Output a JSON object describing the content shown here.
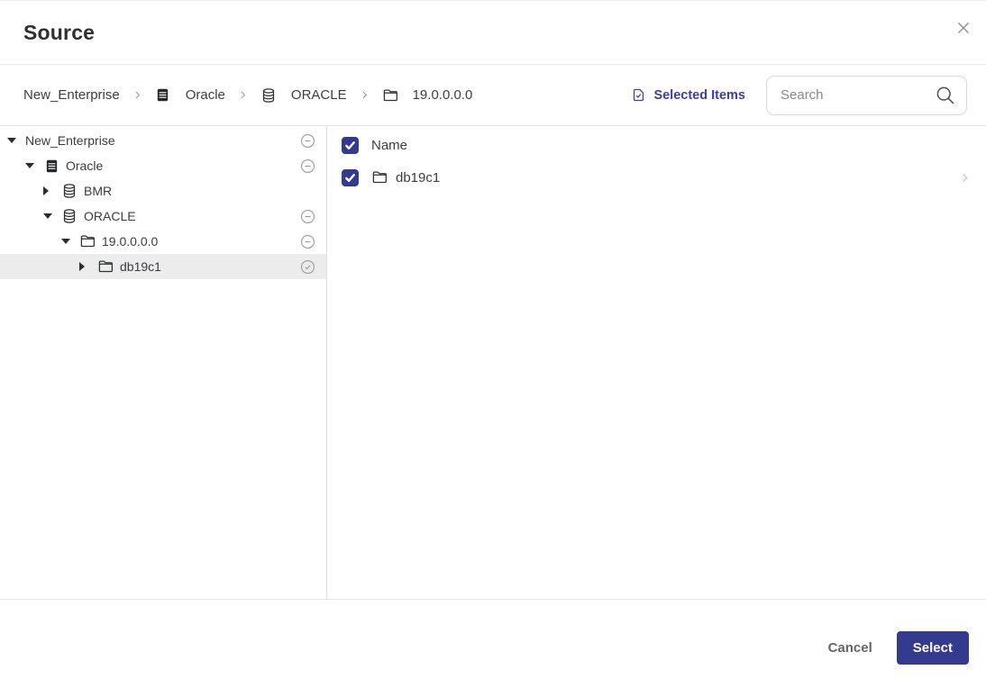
{
  "dialog": {
    "title": "Source"
  },
  "colors": {
    "accent": "#343a8e",
    "link": "#3d3f9c",
    "selected_row_bg": "#ececec",
    "status_icon_gray": "#9c9c9c"
  },
  "breadcrumb": {
    "items": [
      {
        "label": "New_Enterprise",
        "icon": null
      },
      {
        "label": "Oracle",
        "icon": "table-icon"
      },
      {
        "label": "ORACLE",
        "icon": "database-icon"
      },
      {
        "label": "19.0.0.0.0",
        "icon": "folder-icon"
      }
    ]
  },
  "toolbar": {
    "selected_items_label": "Selected Items",
    "selected_items_icon": "document-check-icon",
    "search_placeholder": "Search",
    "search_icon": "magnifier-icon"
  },
  "tree": {
    "items": [
      {
        "label": "New_Enterprise",
        "level": 0,
        "expanded": true,
        "icon": null,
        "status": "minus-circle",
        "selected": false
      },
      {
        "label": "Oracle",
        "level": 1,
        "expanded": true,
        "icon": "table-icon",
        "status": "minus-circle",
        "selected": false
      },
      {
        "label": "BMR",
        "level": 2,
        "expanded": false,
        "icon": "database-icon",
        "status": null,
        "selected": false
      },
      {
        "label": "ORACLE",
        "level": 2,
        "expanded": true,
        "icon": "database-icon",
        "status": "minus-circle",
        "selected": false
      },
      {
        "label": "19.0.0.0.0",
        "level": 3,
        "expanded": true,
        "icon": "folder-icon",
        "status": "minus-circle",
        "selected": false
      },
      {
        "label": "db19c1",
        "level": 4,
        "expanded": false,
        "icon": "folder-icon",
        "status": "check-circle",
        "selected": true
      }
    ]
  },
  "list": {
    "header": {
      "label": "Name",
      "checked": true
    },
    "rows": [
      {
        "label": "db19c1",
        "checked": true,
        "icon": "folder-icon",
        "chevron": true
      }
    ]
  },
  "footer": {
    "cancel_label": "Cancel",
    "select_label": "Select"
  }
}
